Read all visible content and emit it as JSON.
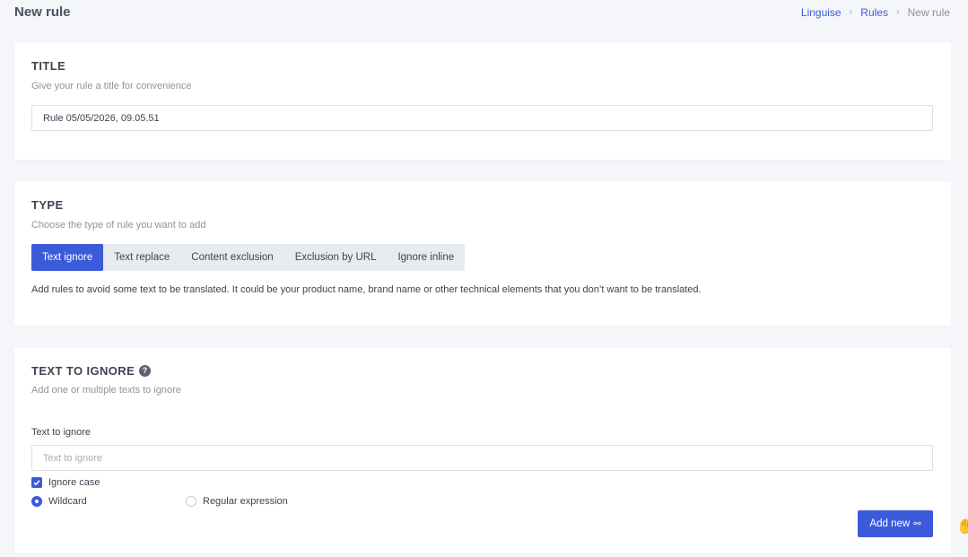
{
  "header": {
    "title": "New rule",
    "breadcrumb": [
      {
        "label": "Linguise"
      },
      {
        "label": "Rules"
      },
      {
        "label": "New rule"
      }
    ]
  },
  "title_section": {
    "heading": "TITLE",
    "description": "Give your rule a title for convenience",
    "input_value": "Rule 05/05/2026, 09.05.51"
  },
  "type_section": {
    "heading": "TYPE",
    "description": "Choose the type of rule you want to add",
    "tabs": [
      {
        "label": "Text ignore",
        "active": true
      },
      {
        "label": "Text replace",
        "active": false
      },
      {
        "label": "Content exclusion",
        "active": false
      },
      {
        "label": "Exclusion by URL",
        "active": false
      },
      {
        "label": "Ignore inline",
        "active": false
      }
    ],
    "help_text": "Add rules to avoid some text to be translated. It could be your product name, brand name or other technical elements that you don’t want to be translated."
  },
  "ignore_section": {
    "heading": "TEXT TO IGNORE",
    "help_icon": "?",
    "description": "Add one or multiple texts to ignore",
    "field_label": "Text to ignore",
    "input_placeholder": "Text to ignore",
    "ignore_case_label": "Ignore case",
    "ignore_case_checked": true,
    "match_options": [
      {
        "label": "Wildcard",
        "selected": true
      },
      {
        "label": "Regular expression",
        "selected": false
      }
    ],
    "add_button_label": "Add new"
  },
  "colors": {
    "accent": "#3b5bdb",
    "background": "#f5f6fa",
    "card": "#ffffff"
  }
}
